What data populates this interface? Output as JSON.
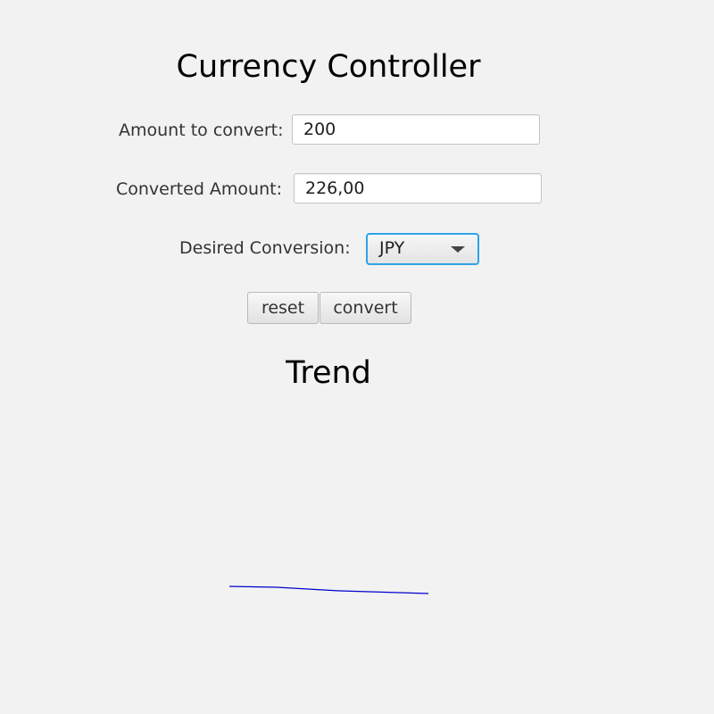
{
  "app": {
    "title": "Currency Controller"
  },
  "form": {
    "amount_label": "Amount to convert:",
    "amount_value": "200",
    "converted_label": "Converted Amount:",
    "converted_value": "226,00",
    "conversion_label": "Desired Conversion:",
    "conversion_selected": "JPY"
  },
  "buttons": {
    "reset_label": "reset",
    "convert_label": "convert"
  },
  "trend": {
    "title": "Trend",
    "line_color": "#0000cc"
  },
  "colors": {
    "background": "#f2f2f2",
    "focus_accent": "#2ea3e6"
  }
}
